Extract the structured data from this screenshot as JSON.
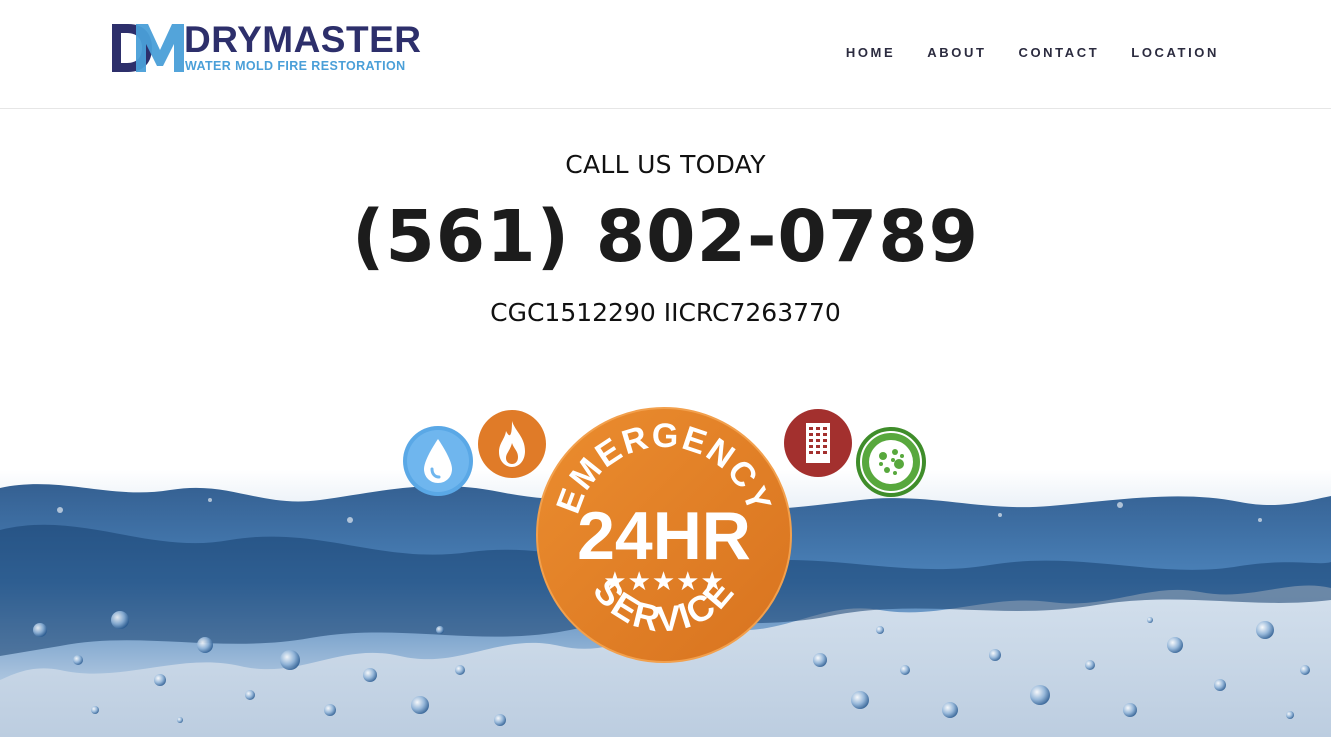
{
  "brand": {
    "name": "DRYMASTER",
    "tagline": "WATER MOLD FIRE RESTORATION",
    "mark": "DM",
    "colors": {
      "navy": "#2d2f6b",
      "light_blue": "#4a9fd8"
    }
  },
  "nav": {
    "items": [
      {
        "label": "HOME"
      },
      {
        "label": "ABOUT"
      },
      {
        "label": "CONTACT"
      },
      {
        "label": "LOCATION"
      }
    ]
  },
  "hero": {
    "call_label": "CALL US TODAY",
    "phone": "(561) 802-0789",
    "license": "CGC1512290 IICRC7263770"
  },
  "badge": {
    "top_text": "EMERGENCY",
    "main_text": "24HR",
    "stars": "★★★★★",
    "bottom_text": "SERVICE",
    "color": "#e8852a"
  },
  "service_icons": [
    {
      "name": "water-drop-icon",
      "color": "#5aa8e6"
    },
    {
      "name": "fire-icon",
      "color": "#e07b28"
    },
    {
      "name": "building-icon",
      "color": "#a3302e"
    },
    {
      "name": "mold-icon",
      "color": "#3f8d2a"
    }
  ]
}
